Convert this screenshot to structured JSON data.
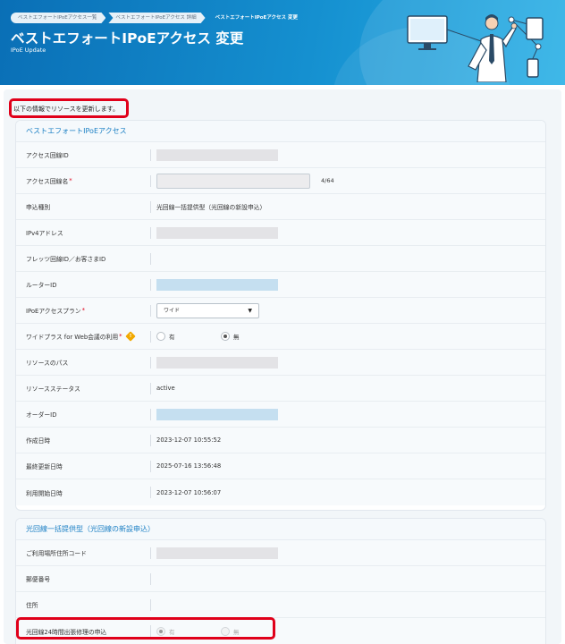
{
  "breadcrumbs": [
    {
      "label": "ベストエフォートIPoEアクセス一覧"
    },
    {
      "label": "ベストエフォートIPoEアクセス 詳細"
    },
    {
      "label": "ベストエフォートIPoEアクセス 変更"
    }
  ],
  "page": {
    "title": "ベストエフォートIPoEアクセス 変更",
    "subtitle": "IPoE Update",
    "intro": "以下の情報でリソースを更新します。"
  },
  "section1": {
    "title": "ベストエフォートIPoEアクセス",
    "rows": {
      "access_line_id": {
        "label": "アクセス回線ID"
      },
      "access_line_name": {
        "label": "アクセス回線名",
        "required": "*",
        "counter": "4/64"
      },
      "application_type": {
        "label": "申込種別",
        "value": "光回線一括提供型（光回線の新設申込）"
      },
      "ipv4": {
        "label": "IPv4アドレス"
      },
      "flets_id": {
        "label": "フレッツ回線ID／お客さまID"
      },
      "router_id": {
        "label": "ルーターID"
      },
      "plan": {
        "label": "IPoEアクセスプラン",
        "required": "*",
        "selected": "ワイド",
        "arrow": "▼"
      },
      "wide_plus": {
        "label": "ワイドプラス for Web会議の利用",
        "required": "*",
        "info": "!",
        "options": [
          "有",
          "無"
        ],
        "selected": "無"
      },
      "resource_path": {
        "label": "リソースのパス"
      },
      "resource_status": {
        "label": "リソースステータス",
        "value": "active"
      },
      "order_id": {
        "label": "オーダーID"
      },
      "created_at": {
        "label": "作成日時",
        "value": "2023-12-07 10:55:52"
      },
      "updated_at": {
        "label": "最終更新日時",
        "value": "2025-07-16 13:56:48"
      },
      "started_at": {
        "label": "利用開始日時",
        "value": "2023-12-07 10:56:07"
      }
    }
  },
  "section2": {
    "title": "光回線一括提供型（光回線の新設申込）",
    "rows": {
      "address_code": {
        "label": "ご利用場所住所コード"
      },
      "postal_code": {
        "label": "郵便番号"
      },
      "address": {
        "label": "住所"
      },
      "repair_24h": {
        "label": "光回線24時間出張修理の申込",
        "options": [
          "有",
          "無"
        ],
        "selected": "有"
      }
    }
  },
  "colors": {
    "header_blue": "#1590d0",
    "accent_blue": "#1a7fc4",
    "highlight_red": "#e0001a",
    "required_red": "#e0001a",
    "info_orange": "#f2a900"
  },
  "icons": {
    "info": "info-diamond-icon",
    "dropdown": "chevron-down-icon",
    "illustration": "businessman-devices-illustration"
  }
}
